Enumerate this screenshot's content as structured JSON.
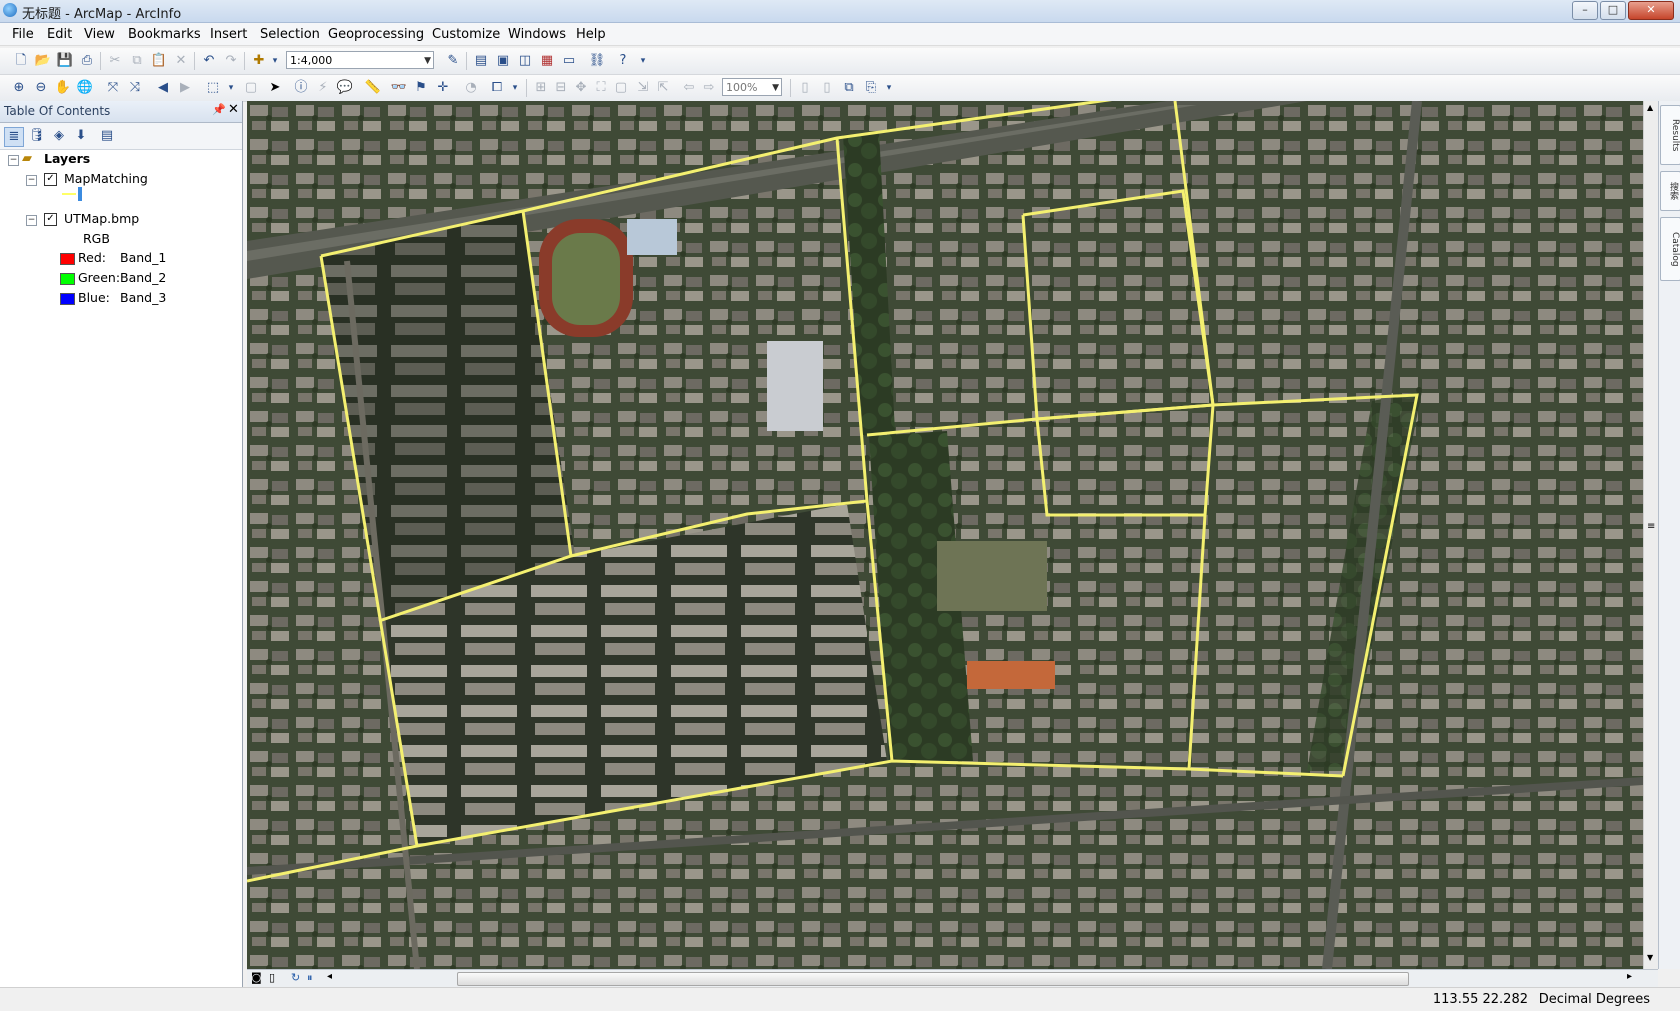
{
  "window": {
    "title": "无标题 - ArcMap - ArcInfo",
    "controls": [
      "–",
      "□",
      "✕"
    ]
  },
  "menu": [
    "File",
    "Edit",
    "View",
    "Bookmarks",
    "Insert",
    "Selection",
    "Geoprocessing",
    "Customize",
    "Windows",
    "Help"
  ],
  "toolbar": {
    "scale": "1:4,000",
    "zoom_percent": "100%"
  },
  "toc": {
    "title": "Table Of Contents",
    "root": "Layers",
    "layers": [
      {
        "name": "MapMatching",
        "checked": true,
        "symbol_color": "#ffff66"
      },
      {
        "name": "UTMap.bmp",
        "checked": true,
        "renderer": "RGB",
        "bands": [
          {
            "channel": "Red:",
            "band": "Band_1",
            "color": "#ff0000"
          },
          {
            "channel": "Green:",
            "band": "Band_2",
            "color": "#00ff00"
          },
          {
            "channel": "Blue:",
            "band": "Band_3",
            "color": "#0000ff"
          }
        ]
      }
    ]
  },
  "right_dock": [
    "Results",
    "搜索",
    "Catalog"
  ],
  "status": {
    "coordinates": "113.55  22.282",
    "units": "Decimal Degrees"
  },
  "colors": {
    "boundary": "#f4f070",
    "imagery_base": "#3e4a34"
  }
}
